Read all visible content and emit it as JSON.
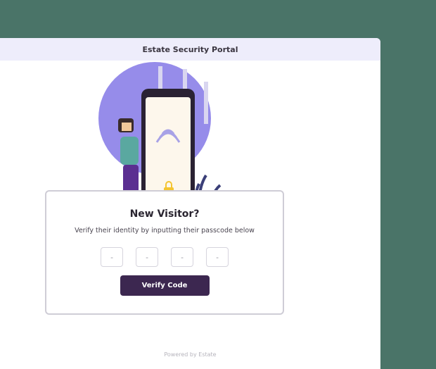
{
  "window": {
    "title": "Estate Security Portal"
  },
  "card": {
    "title": "New Visitor?",
    "subtitle": "Verify their identity by inputting their passcode below",
    "code_fields": [
      "-",
      "-",
      "-",
      "-"
    ],
    "verify_label": "Verify Code"
  },
  "footer": {
    "text": "Powered by Estate"
  },
  "icons": {
    "illustration": "security-phone-illustration"
  },
  "colors": {
    "desktop": "#4a7468",
    "titlebar": "#eeedfb",
    "accent": "#3c2750",
    "illustration_purple": "#8b80e8"
  }
}
